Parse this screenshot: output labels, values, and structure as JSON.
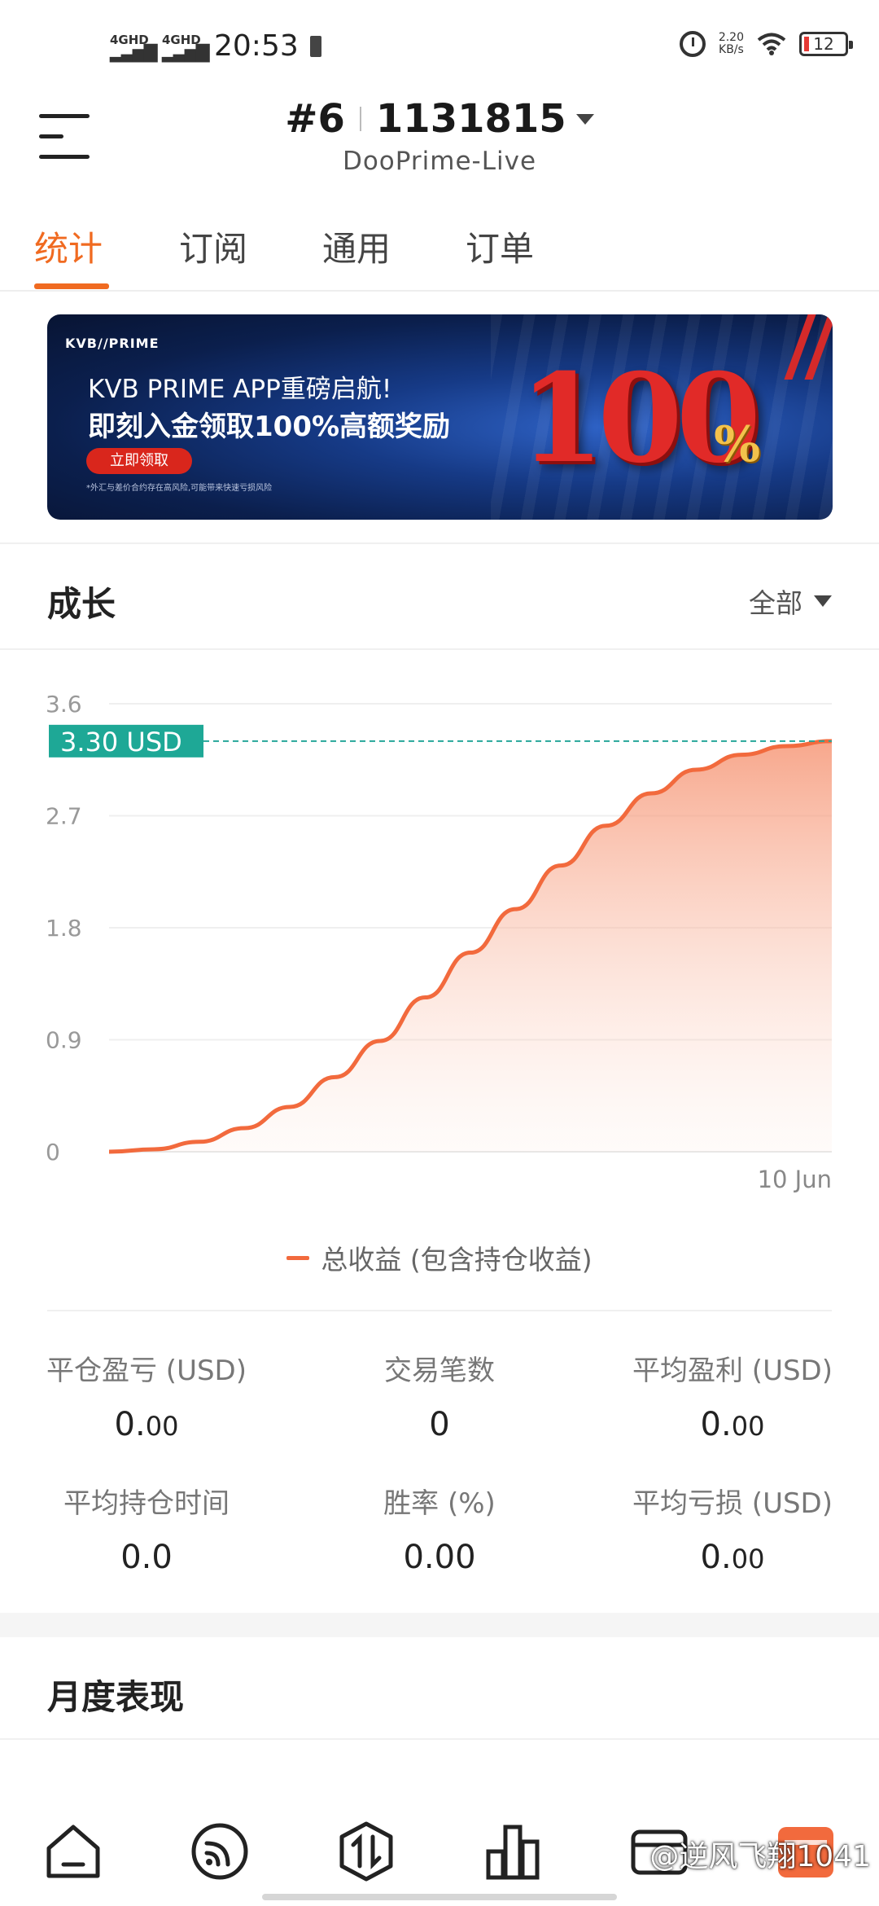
{
  "status_bar": {
    "network1": "4GHD",
    "network2": "4GHD",
    "time": "20:53",
    "speed_value": "2.20",
    "speed_unit": "KB/s",
    "battery": "12"
  },
  "header": {
    "account_number": "#6",
    "account_id": "1131815",
    "server": "DooPrime-Live"
  },
  "tabs": [
    {
      "label": "统计",
      "active": true
    },
    {
      "label": "订阅",
      "active": false
    },
    {
      "label": "通用",
      "active": false
    },
    {
      "label": "订单",
      "active": false
    }
  ],
  "banner": {
    "logo": "KVB//PRIME",
    "line1": "KVB PRIME APP重磅启航!",
    "line2": "即刻入金领取100%高额奖励",
    "button": "立即领取",
    "note": "*外汇与差价合约存在高风险,可能带来快速亏损风险",
    "big_number": "100",
    "big_percent": "%"
  },
  "growth": {
    "title": "成长",
    "filter": "全部"
  },
  "chart_data": {
    "type": "area",
    "y_ticks": [
      "3.6",
      "2.7",
      "1.8",
      "0.9",
      "0"
    ],
    "ylim": [
      0,
      3.6
    ],
    "x_tick": "10 Jun",
    "current_value_label": "3.30 USD",
    "current_value": 3.3,
    "series": [
      {
        "name": "总收益 (包含持仓收益)",
        "values": [
          0,
          0.02,
          0.08,
          0.19,
          0.36,
          0.6,
          0.89,
          1.24,
          1.6,
          1.95,
          2.3,
          2.62,
          2.88,
          3.07,
          3.19,
          3.26,
          3.3
        ],
        "color": "#f26a3d"
      }
    ],
    "grid": true
  },
  "legend_label": "总收益 (包含持仓收益)",
  "stats": [
    {
      "label": "平仓盈亏 (USD)",
      "int": "0.",
      "dec": "00"
    },
    {
      "label": "交易笔数",
      "int": "0",
      "dec": ""
    },
    {
      "label": "平均盈利 (USD)",
      "int": "0.",
      "dec": "00"
    },
    {
      "label": "平均持仓时间",
      "int": "0.0",
      "dec": ""
    },
    {
      "label": "胜率 (%)",
      "int": "0.00",
      "dec": ""
    },
    {
      "label": "平均亏损 (USD)",
      "int": "0.",
      "dec": "00"
    }
  ],
  "monthly": {
    "title": "月度表现"
  },
  "bottom_nav": [
    {
      "icon": "home-icon"
    },
    {
      "icon": "signal-icon"
    },
    {
      "icon": "trade-icon"
    },
    {
      "icon": "chart-bar-icon"
    },
    {
      "icon": "card-icon"
    },
    {
      "icon": "calendar-icon"
    }
  ],
  "watermark": "@逆风飞翔1041"
}
